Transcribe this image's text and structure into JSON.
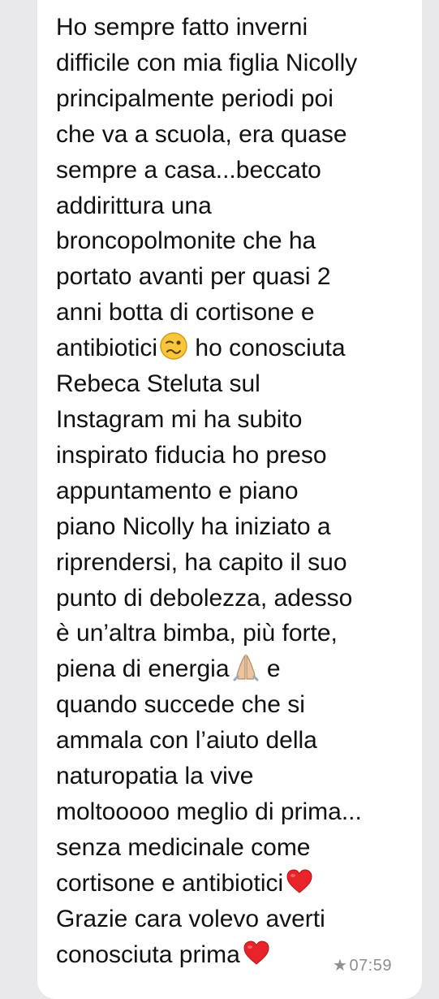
{
  "message": {
    "lines": [
      "Ho sempre fatto inverni",
      "difficile con mia figlia Nicolly",
      "principalmente periodi poi",
      "che va a scuola, era quase",
      "sempre a casa...beccato",
      "addirittura una",
      "broncopolmonite che ha",
      "portato avanti per quasi 2",
      "anni botta di cortisone e",
      "antibiotici",
      " ho conosciuta",
      "Rebeca Steluta sul",
      "Instagram mi ha subito",
      "inspirato fiducia ho preso",
      "appuntamento e piano",
      "piano Nicolly ha iniziato a",
      "riprendersi, ha capito il suo",
      "punto di debolezza, adesso",
      "è un’altra bimba, più forte,",
      "piena di energia",
      " e",
      "quando succede che si",
      "ammala con l’aiuto della",
      "naturopatia la vive",
      "moltooooo meglio di prima...",
      "senza medicinale come",
      "cortisone e antibiotici",
      "Grazie cara volevo averti",
      "conosciuta prima"
    ],
    "emojis": [
      "woozy-face-icon",
      "folded-hands-icon",
      "red-heart-icon",
      "red-heart-icon"
    ]
  },
  "meta": {
    "star": "★",
    "time": "07:59"
  },
  "colors": {
    "background": "#e9e9eb",
    "bubble": "#ffffff",
    "text": "#111111",
    "meta": "#8e8e93",
    "heart": "#e8232a"
  }
}
